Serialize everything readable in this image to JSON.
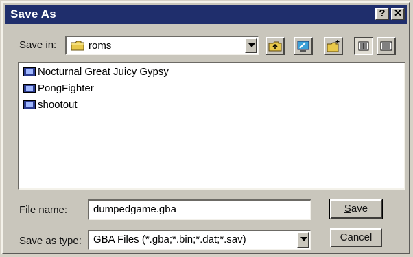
{
  "window": {
    "title": "Save As",
    "help_label": "?",
    "close_label": "✕",
    "titlebar_color": "#1f2e6c"
  },
  "save_in": {
    "label_u": "i",
    "label_pre": "Save ",
    "label_post": "n:",
    "folder": "roms"
  },
  "toolbar": {
    "icons": [
      "up-folder-icon",
      "desktop-icon",
      "new-folder-icon",
      "list-view-icon",
      "details-view-icon"
    ]
  },
  "files": [
    {
      "name": "Nocturnal Great Juicy Gypsy"
    },
    {
      "name": "PongFighter"
    },
    {
      "name": "shootout"
    }
  ],
  "file_name": {
    "label_pre": "File ",
    "label_u": "n",
    "label_post": "ame:",
    "value": "dumpedgame.gba"
  },
  "save_as_type": {
    "label_pre": "Save as ",
    "label_u": "t",
    "label_post": "ype:",
    "value": "GBA Files (*.gba;*.bin;*.dat;*.sav)"
  },
  "buttons": {
    "save_u": "S",
    "save_rest": "ave",
    "cancel": "Cancel"
  }
}
